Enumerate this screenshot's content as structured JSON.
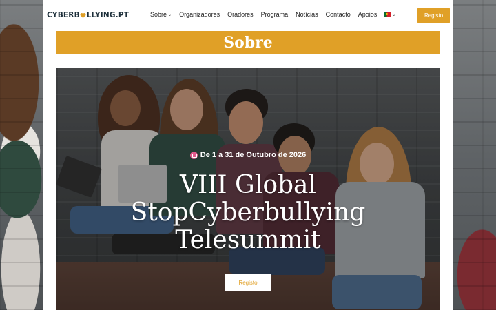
{
  "header": {
    "logo_text_a": "CYBERB",
    "logo_text_b": "LLYING.PT",
    "logo_icon": "heart-icon",
    "nav": [
      {
        "label": "Sobre",
        "has_dropdown": true
      },
      {
        "label": "Organizadores",
        "has_dropdown": false
      },
      {
        "label": "Oradores",
        "has_dropdown": false
      },
      {
        "label": "Programa",
        "has_dropdown": false
      },
      {
        "label": "Notícias",
        "has_dropdown": false
      },
      {
        "label": "Contacto",
        "has_dropdown": false
      },
      {
        "label": "Apoios",
        "has_dropdown": false
      }
    ],
    "language_icon": "portugal-flag-icon",
    "register_label": "Registo"
  },
  "page": {
    "title": "Sobre"
  },
  "hero": {
    "date_icon": "calendar-icon",
    "date_text": "De 1 a 31 de Outubro de 2026",
    "title_line1": "VIII Global",
    "title_line2": "StopCyberbullying",
    "title_line3": "Telesummit",
    "button_label": "Registo"
  },
  "colors": {
    "accent": "#e0a027",
    "logo": "#1d2f3a",
    "white": "#ffffff"
  }
}
